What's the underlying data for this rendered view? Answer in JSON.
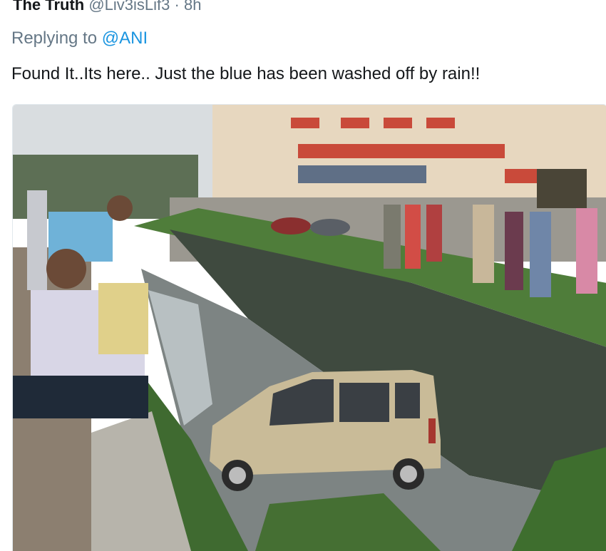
{
  "tweet": {
    "author_name": "The Truth",
    "author_handle": "@Liv3isLif3",
    "separator": "·",
    "time": "8h",
    "replying_prefix": "Replying to",
    "replying_mention": "@ANI",
    "text": "Found It..Its here.. Just the blue has been washed off by rain!!"
  },
  "media": {
    "description_icon": "photo-icon",
    "colors": {
      "sky": "#d9dde0",
      "building": "#e7d7bf",
      "awning": "#c94a3a",
      "grass": "#4f7d3a",
      "wall": "#3f4a3f",
      "water": "#7d8483",
      "car": "#c9bb98"
    }
  }
}
